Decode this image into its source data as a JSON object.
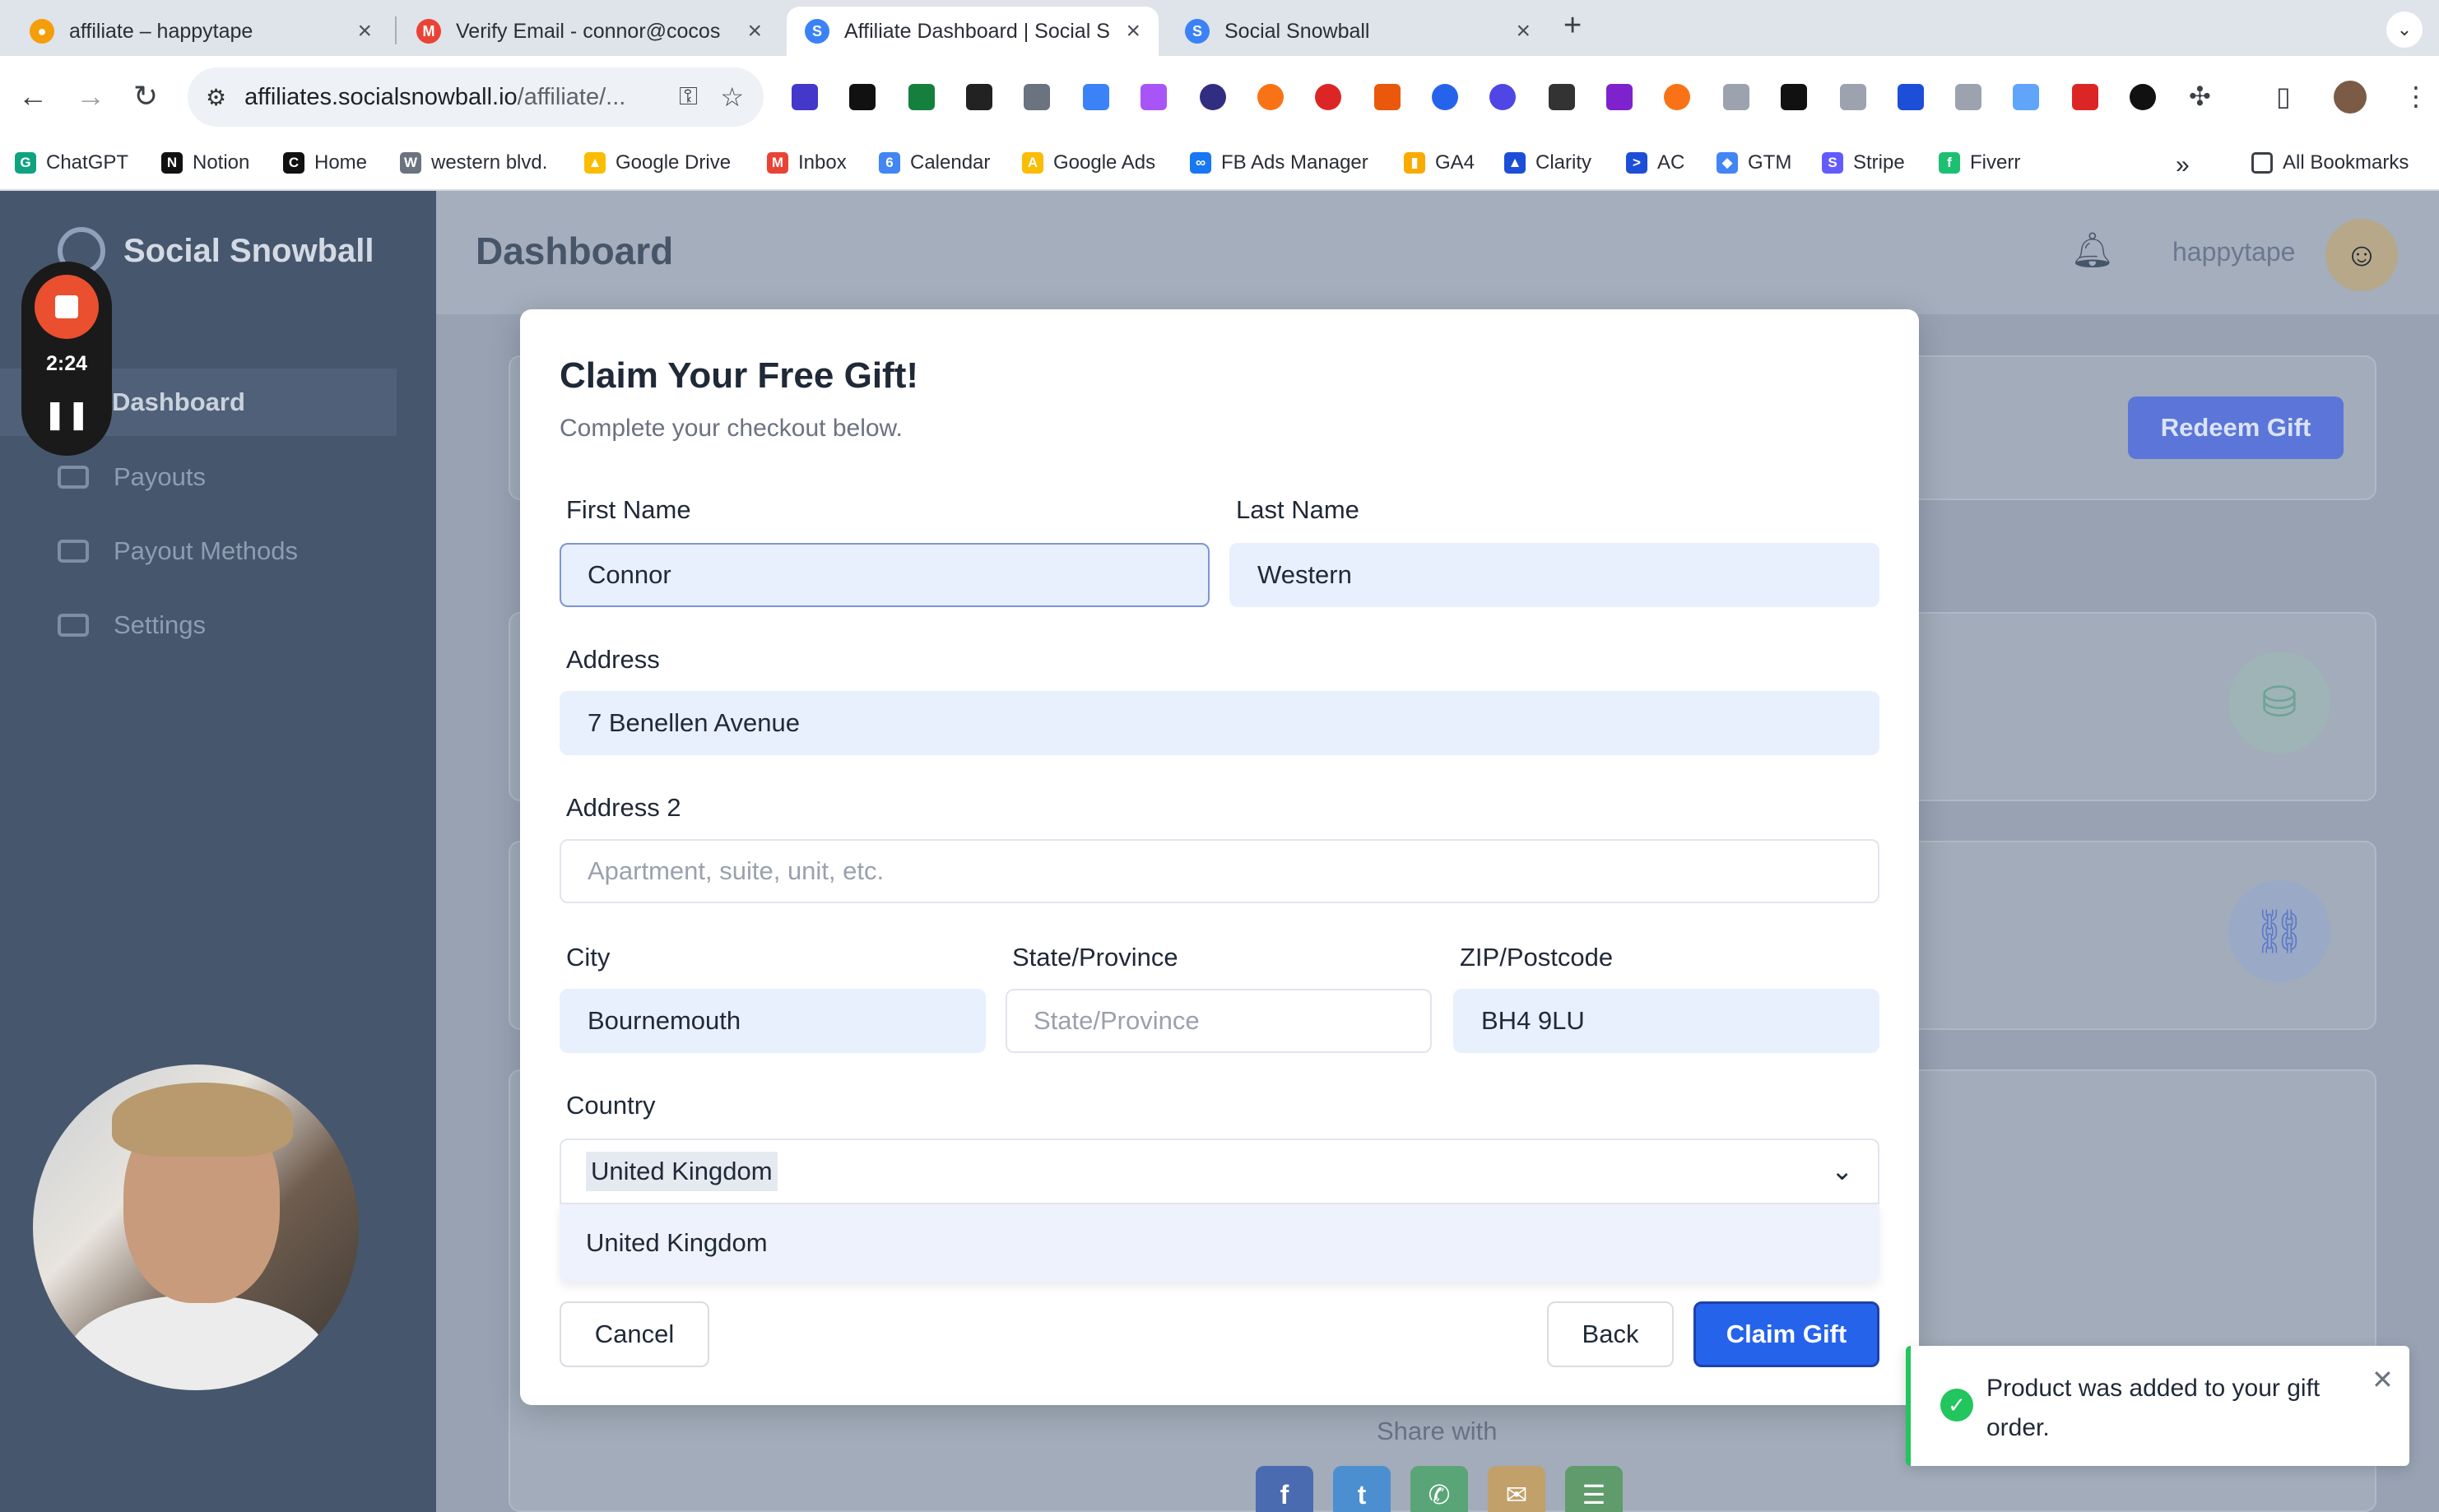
{
  "browser": {
    "tabs": [
      {
        "title": "affiliate – happytape",
        "favicon_color": "#f59e0b"
      },
      {
        "title": "Verify Email - connor@cocos",
        "favicon_color": "#ea4335"
      },
      {
        "title": "Affiliate Dashboard | Social S",
        "favicon_color": "#3b82f6"
      },
      {
        "title": "Social Snowball",
        "favicon_color": "#3b82f6"
      }
    ],
    "new_tab": "+",
    "url_host": "affiliates.socialsnowball.io",
    "url_path": "/affiliate/...",
    "bookmarks": [
      {
        "label": "ChatGPT",
        "color": "#10a37f",
        "glyph": "G"
      },
      {
        "label": "Notion",
        "color": "#111111",
        "glyph": "N"
      },
      {
        "label": "Home",
        "color": "#111111",
        "glyph": "C"
      },
      {
        "label": "western blvd.",
        "color": "#6b7280",
        "glyph": "W"
      },
      {
        "label": "Google Drive",
        "color": "#fbbc04",
        "glyph": "▲"
      },
      {
        "label": "Inbox",
        "color": "#ea4335",
        "glyph": "M"
      },
      {
        "label": "Calendar",
        "color": "#4285f4",
        "glyph": "6"
      },
      {
        "label": "Google Ads",
        "color": "#fbbc04",
        "glyph": "A"
      },
      {
        "label": "FB Ads Manager",
        "color": "#1877f2",
        "glyph": "∞"
      },
      {
        "label": "GA4",
        "color": "#f9ab00",
        "glyph": "▮"
      },
      {
        "label": "Clarity",
        "color": "#1d4ed8",
        "glyph": "▲"
      },
      {
        "label": "AC",
        "color": "#1d4ed8",
        "glyph": ">"
      },
      {
        "label": "GTM",
        "color": "#4285f4",
        "glyph": "◆"
      },
      {
        "label": "Stripe",
        "color": "#635bff",
        "glyph": "S"
      },
      {
        "label": "Fiverr",
        "color": "#1dbf73",
        "glyph": "f"
      }
    ],
    "more_bookmarks": "»",
    "all_bookmarks": "All Bookmarks"
  },
  "recorder": {
    "time": "2:24",
    "pause_glyph": "❚❚"
  },
  "app": {
    "brand": "Social Snowball",
    "nav": [
      {
        "label": "Dashboard",
        "icon": "home-icon"
      },
      {
        "label": "Payouts",
        "icon": "payouts-icon"
      },
      {
        "label": "Payout Methods",
        "icon": "card-icon"
      },
      {
        "label": "Settings",
        "icon": "settings-icon"
      }
    ],
    "page_title": "Dashboard",
    "username": "happytape",
    "avatar_glyph": "☺",
    "redeem_label": "Redeem Gift",
    "share_label": "Share with"
  },
  "modal": {
    "title": "Claim Your Free Gift!",
    "subtitle": "Complete your checkout below.",
    "first_name": {
      "label": "First Name",
      "value": "Connor"
    },
    "last_name": {
      "label": "Last Name",
      "value": "Western"
    },
    "address": {
      "label": "Address",
      "value": "7 Benellen Avenue"
    },
    "address2": {
      "label": "Address 2",
      "placeholder": "Apartment, suite, unit, etc."
    },
    "city": {
      "label": "City",
      "value": "Bournemouth"
    },
    "state": {
      "label": "State/Province",
      "placeholder": "State/Province"
    },
    "zip": {
      "label": "ZIP/Postcode",
      "value": "BH4 9LU"
    },
    "country": {
      "label": "Country",
      "value": "United Kingdom",
      "options": [
        "United Kingdom"
      ]
    },
    "cancel_label": "Cancel",
    "back_label": "Back",
    "claim_label": "Claim Gift"
  },
  "toast": {
    "message": "Product was added to your gift order.",
    "close": "✕"
  },
  "colors": {
    "primary": "#2563eb",
    "success": "#22c55e",
    "sidebar": "#46566d"
  }
}
